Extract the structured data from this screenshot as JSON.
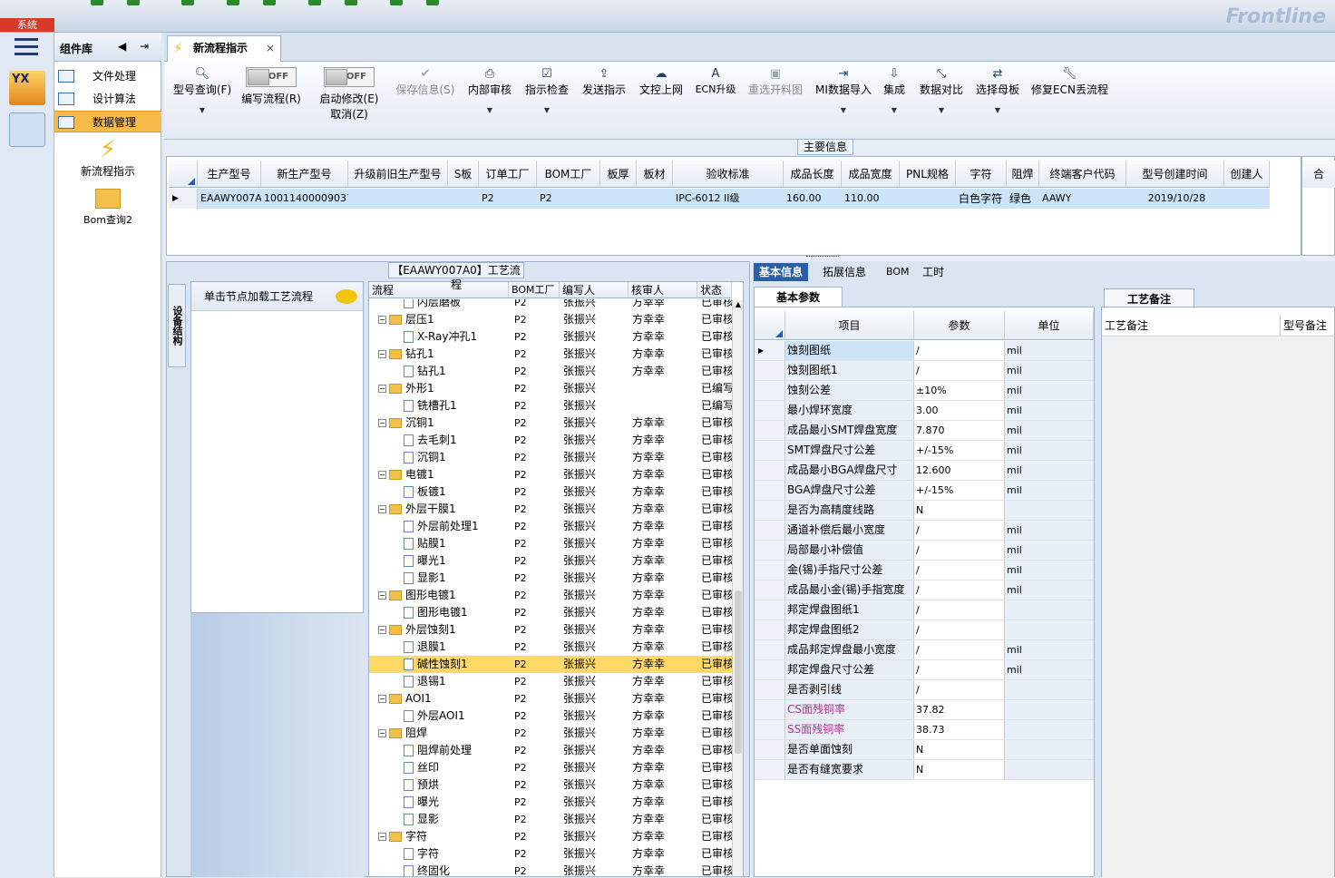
{
  "topbar": {
    "sys_label": "系统",
    "brand": "Frontline"
  },
  "component_library": {
    "title": "组件库",
    "menu": [
      {
        "label": "文件处理"
      },
      {
        "label": "设计算法"
      },
      {
        "label": "数据管理"
      }
    ],
    "items": [
      {
        "label": "新流程指示"
      },
      {
        "label": "Bom查询2"
      }
    ]
  },
  "tab": {
    "label": "新流程指示",
    "close": "×"
  },
  "toolbar": {
    "buttons": [
      {
        "label": "型号查询(F)",
        "icon": "search-icon"
      },
      {
        "label": "编写流程(R)",
        "toggle": "OFF"
      },
      {
        "label": "启动修改(E)",
        "label2": "取消(Z)",
        "toggle": "OFF"
      },
      {
        "label": "保存信息(S)",
        "icon": "check-icon"
      },
      {
        "label": "内部审核",
        "icon": "print-icon"
      },
      {
        "label": "指示检查",
        "icon": "checkbox-icon"
      },
      {
        "label": "发送指示",
        "icon": "upload-icon"
      },
      {
        "label": "文控上网",
        "icon": "cloud-upload-icon"
      },
      {
        "label": "ECN升级",
        "icon": "font-icon"
      },
      {
        "label": "重选开料图",
        "icon": "image-icon"
      },
      {
        "label": "MI数据导入",
        "icon": "signin-icon"
      },
      {
        "label": "集成",
        "icon": "download-icon"
      },
      {
        "label": "数据对比",
        "icon": "compress-icon"
      },
      {
        "label": "选择母板",
        "icon": "random-icon"
      },
      {
        "label": "修复ECN丢流程",
        "icon": "wrench-icon"
      }
    ]
  },
  "main_info": {
    "label": "主要信息",
    "columns": [
      "生产型号",
      "新生产型号",
      "升级前旧生产型号",
      "S板",
      "订单工厂",
      "BOM工厂",
      "板厚",
      "板材",
      "验收标准",
      "成品长度",
      "成品宽度",
      "PNL规格",
      "字符",
      "阻焊",
      "终端客户代码",
      "型号创建时间",
      "创建人"
    ],
    "row": {
      "生产型号": "EAAWY007A0",
      "新生产型号": "10011400009037",
      "升级前旧生产型号": "",
      "S板": "",
      "订单工厂": "P2",
      "BOM工厂": "P2",
      "板厚": "",
      "板材": "",
      "验收标准": "IPC-6012 II级",
      "成品长度": "160.00",
      "成品宽度": "110.00",
      "PNL规格": "",
      "字符": "白色字符",
      "阻焊": "绿色",
      "终端客户代码": "AAWY",
      "型号创建时间": "2019/10/28",
      "创建人": ""
    },
    "extra_col": "合"
  },
  "flow": {
    "title": "【EAAWY007A0】工艺流程",
    "side_tab": "设备结构",
    "left_head": "单击节点加载工艺流程",
    "columns": [
      "流程",
      "BOM工厂",
      "编写人",
      "核审人",
      "状态"
    ],
    "rows": [
      {
        "name": "内层磨板",
        "level": 2,
        "type": "doc",
        "bom": "P2",
        "writer": "张振兴",
        "reviewer": "方幸幸",
        "status": "已审核"
      },
      {
        "name": "层压1",
        "level": 1,
        "type": "folder",
        "bom": "P2",
        "writer": "张振兴",
        "reviewer": "方幸幸",
        "status": "已审核"
      },
      {
        "name": "X-Ray冲孔1",
        "level": 2,
        "type": "doc",
        "bom": "P2",
        "writer": "张振兴",
        "reviewer": "方幸幸",
        "status": "已审核"
      },
      {
        "name": "钻孔1",
        "level": 1,
        "type": "folder",
        "bom": "P2",
        "writer": "张振兴",
        "reviewer": "方幸幸",
        "status": "已审核"
      },
      {
        "name": "钻孔1",
        "level": 2,
        "type": "doc",
        "bom": "P2",
        "writer": "张振兴",
        "reviewer": "方幸幸",
        "status": "已审核"
      },
      {
        "name": "外形1",
        "level": 1,
        "type": "folder",
        "bom": "P2",
        "writer": "张振兴",
        "reviewer": "",
        "status": "已编写"
      },
      {
        "name": "铣槽孔1",
        "level": 2,
        "type": "doc",
        "bom": "P2",
        "writer": "张振兴",
        "reviewer": "",
        "status": "已编写"
      },
      {
        "name": "沉铜1",
        "level": 1,
        "type": "folder",
        "bom": "P2",
        "writer": "张振兴",
        "reviewer": "方幸幸",
        "status": "已审核"
      },
      {
        "name": "去毛刺1",
        "level": 2,
        "type": "doc",
        "bom": "P2",
        "writer": "张振兴",
        "reviewer": "方幸幸",
        "status": "已审核"
      },
      {
        "name": "沉铜1",
        "level": 2,
        "type": "doc",
        "bom": "P2",
        "writer": "张振兴",
        "reviewer": "方幸幸",
        "status": "已审核"
      },
      {
        "name": "电镀1",
        "level": 1,
        "type": "folder",
        "bom": "P2",
        "writer": "张振兴",
        "reviewer": "方幸幸",
        "status": "已审核"
      },
      {
        "name": "板镀1",
        "level": 2,
        "type": "doc",
        "bom": "P2",
        "writer": "张振兴",
        "reviewer": "方幸幸",
        "status": "已审核"
      },
      {
        "name": "外层干膜1",
        "level": 1,
        "type": "folder",
        "bom": "P2",
        "writer": "张振兴",
        "reviewer": "方幸幸",
        "status": "已审核"
      },
      {
        "name": "外层前处理1",
        "level": 2,
        "type": "doc",
        "bom": "P2",
        "writer": "张振兴",
        "reviewer": "方幸幸",
        "status": "已审核"
      },
      {
        "name": "贴膜1",
        "level": 2,
        "type": "doc",
        "bom": "P2",
        "writer": "张振兴",
        "reviewer": "方幸幸",
        "status": "已审核"
      },
      {
        "name": "曝光1",
        "level": 2,
        "type": "doc",
        "bom": "P2",
        "writer": "张振兴",
        "reviewer": "方幸幸",
        "status": "已审核"
      },
      {
        "name": "显影1",
        "level": 2,
        "type": "doc",
        "bom": "P2",
        "writer": "张振兴",
        "reviewer": "方幸幸",
        "status": "已审核"
      },
      {
        "name": "图形电镀1",
        "level": 1,
        "type": "folder",
        "bom": "P2",
        "writer": "张振兴",
        "reviewer": "方幸幸",
        "status": "已审核"
      },
      {
        "name": "图形电镀1",
        "level": 2,
        "type": "doc",
        "bom": "P2",
        "writer": "张振兴",
        "reviewer": "方幸幸",
        "status": "已审核"
      },
      {
        "name": "外层蚀刻1",
        "level": 1,
        "type": "folder",
        "bom": "P2",
        "writer": "张振兴",
        "reviewer": "方幸幸",
        "status": "已审核"
      },
      {
        "name": "退膜1",
        "level": 2,
        "type": "doc",
        "bom": "P2",
        "writer": "张振兴",
        "reviewer": "方幸幸",
        "status": "已审核"
      },
      {
        "name": "碱性蚀刻1",
        "level": 2,
        "type": "doc",
        "bom": "P2",
        "writer": "张振兴",
        "reviewer": "方幸幸",
        "status": "已审核",
        "selected": true
      },
      {
        "name": "退锡1",
        "level": 2,
        "type": "doc",
        "bom": "P2",
        "writer": "张振兴",
        "reviewer": "方幸幸",
        "status": "已审核"
      },
      {
        "name": "AOI1",
        "level": 1,
        "type": "folder",
        "bom": "P2",
        "writer": "张振兴",
        "reviewer": "方幸幸",
        "status": "已审核"
      },
      {
        "name": "外层AOI1",
        "level": 2,
        "type": "doc",
        "bom": "P2",
        "writer": "张振兴",
        "reviewer": "方幸幸",
        "status": "已审核"
      },
      {
        "name": "阻焊",
        "level": 1,
        "type": "folder",
        "bom": "P2",
        "writer": "张振兴",
        "reviewer": "方幸幸",
        "status": "已审核"
      },
      {
        "name": "阻焊前处理",
        "level": 2,
        "type": "doc",
        "bom": "P2",
        "writer": "张振兴",
        "reviewer": "方幸幸",
        "status": "已审核"
      },
      {
        "name": "丝印",
        "level": 2,
        "type": "doc",
        "bom": "P2",
        "writer": "张振兴",
        "reviewer": "方幸幸",
        "status": "已审核"
      },
      {
        "name": "预烘",
        "level": 2,
        "type": "doc",
        "bom": "P2",
        "writer": "张振兴",
        "reviewer": "方幸幸",
        "status": "已审核"
      },
      {
        "name": "曝光",
        "level": 2,
        "type": "doc",
        "bom": "P2",
        "writer": "张振兴",
        "reviewer": "方幸幸",
        "status": "已审核"
      },
      {
        "name": "显影",
        "level": 2,
        "type": "doc",
        "bom": "P2",
        "writer": "张振兴",
        "reviewer": "方幸幸",
        "status": "已审核"
      },
      {
        "name": "字符",
        "level": 1,
        "type": "folder",
        "bom": "P2",
        "writer": "张振兴",
        "reviewer": "方幸幸",
        "status": "已审核"
      },
      {
        "name": "字符",
        "level": 2,
        "type": "doc",
        "bom": "P2",
        "writer": "张振兴",
        "reviewer": "方幸幸",
        "status": "已审核"
      },
      {
        "name": "终固化",
        "level": 2,
        "type": "doc",
        "bom": "P2",
        "writer": "张振兴",
        "reviewer": "方幸幸",
        "status": "已审核"
      }
    ]
  },
  "right": {
    "tabs": [
      "基本信息",
      "拓展信息",
      "BOM",
      "工时"
    ],
    "sub_tab": "基本参数",
    "remarks_tab": "工艺备注",
    "remarks_cols": [
      "工艺备注",
      "型号备注"
    ],
    "param_cols": [
      "项目",
      "参数",
      "单位"
    ],
    "params": [
      {
        "item": "蚀刻图纸",
        "value": "/",
        "unit": "mil",
        "selected": true
      },
      {
        "item": "蚀刻图纸1",
        "value": "/",
        "unit": "mil"
      },
      {
        "item": "蚀刻公差",
        "value": "±10%",
        "unit": "mil"
      },
      {
        "item": "最小焊环宽度",
        "value": "3.00",
        "unit": "mil"
      },
      {
        "item": "成品最小SMT焊盘宽度",
        "value": "7.870",
        "unit": "mil"
      },
      {
        "item": "SMT焊盘尺寸公差",
        "value": "+/-15%",
        "unit": "mil"
      },
      {
        "item": "成品最小BGA焊盘尺寸",
        "value": "12.600",
        "unit": "mil"
      },
      {
        "item": "BGA焊盘尺寸公差",
        "value": "+/-15%",
        "unit": "mil"
      },
      {
        "item": "是否为高精度线路",
        "value": "N",
        "unit": ""
      },
      {
        "item": "通道补偿后最小宽度",
        "value": "/",
        "unit": "mil"
      },
      {
        "item": "局部最小补偿值",
        "value": "/",
        "unit": "mil"
      },
      {
        "item": "金(锡)手指尺寸公差",
        "value": "/",
        "unit": "mil"
      },
      {
        "item": "成品最小金(锡)手指宽度",
        "value": "/",
        "unit": "mil"
      },
      {
        "item": "邦定焊盘图纸1",
        "value": "/",
        "unit": ""
      },
      {
        "item": "邦定焊盘图纸2",
        "value": "/",
        "unit": ""
      },
      {
        "item": "成品邦定焊盘最小宽度",
        "value": "/",
        "unit": "mil"
      },
      {
        "item": "邦定焊盘尺寸公差",
        "value": "/",
        "unit": "mil"
      },
      {
        "item": "是否剥引线",
        "value": "/",
        "unit": ""
      },
      {
        "item": "CS面残铜率",
        "value": "37.82",
        "unit": "",
        "color": "#c0309a"
      },
      {
        "item": "SS面残铜率",
        "value": "38.73",
        "unit": "",
        "color": "#c0309a"
      },
      {
        "item": "是否单面蚀刻",
        "value": "N",
        "unit": ""
      },
      {
        "item": "是否有缝宽要求",
        "value": "N",
        "unit": ""
      }
    ]
  }
}
